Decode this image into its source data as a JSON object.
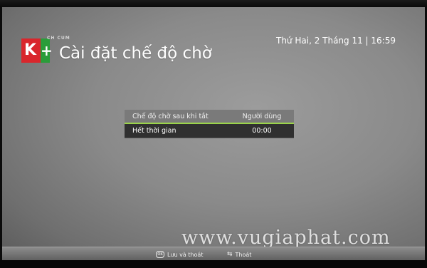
{
  "brand": {
    "logo_text": "K+",
    "logo_subtext": "CH CUM"
  },
  "header": {
    "title": "Cài đặt chế độ chờ",
    "datetime": "Thứ Hai, 2 Tháng 11 | 16:59"
  },
  "settings": {
    "header_row": {
      "label": "Chế độ chờ sau khi tắt",
      "value": "Người dùng"
    },
    "rows": [
      {
        "label": "Hết thời gian",
        "value": "00:00"
      }
    ]
  },
  "footer": {
    "save": {
      "key": "OK",
      "label": "Lưu và thoát"
    },
    "exit": {
      "label": "Thoát"
    }
  },
  "watermark": "www.vugiaphat.com",
  "colors": {
    "accent": "#9bd44a",
    "logo_red": "#d9262c",
    "logo_green": "#2a9d3a"
  }
}
